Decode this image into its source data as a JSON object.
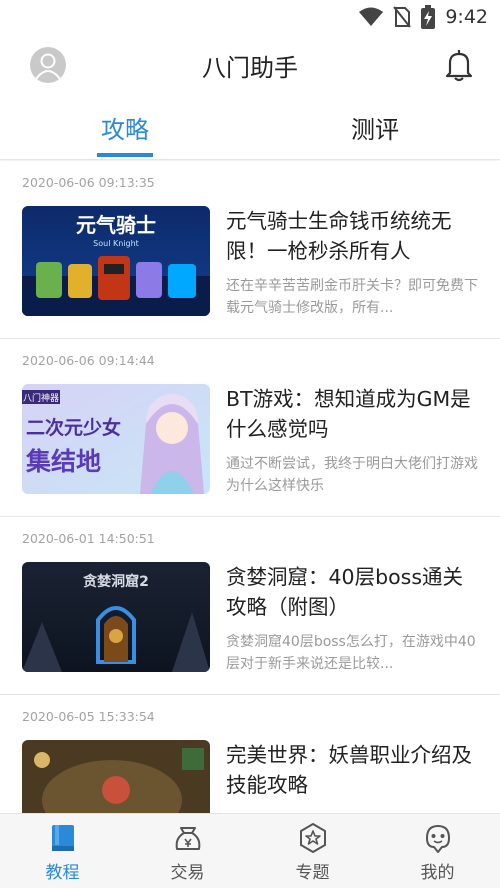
{
  "status_bar": {
    "time": "9:42"
  },
  "header": {
    "title": "八门助手"
  },
  "tabs": [
    {
      "label": "攻略",
      "active": true
    },
    {
      "label": "测评",
      "active": false
    }
  ],
  "articles": [
    {
      "date": "2020-06-06 09:13:35",
      "title": "元气骑士生命钱币统统无限！一枪秒杀所有人",
      "summary": "还在辛辛苦苦刷金币肝关卡？即可免费下载元气骑士修改版，所有...",
      "thumb_text": "元气骑士",
      "thumb_sub": "Soul Knight"
    },
    {
      "date": "2020-06-06 09:14:44",
      "title": "BT游戏：想知道成为GM是什么感觉吗",
      "summary": "通过不断尝试，我终于明白大佬们打游戏为什么这样快乐",
      "thumb_tag": "八门神器",
      "thumb_line1": "二次元少女",
      "thumb_line2": "集结地"
    },
    {
      "date": "2020-06-01 14:50:51",
      "title": "贪婪洞窟：40层boss通关攻略（附图）",
      "summary": "贪婪洞窟40层boss怎么打，在游戏中40层对于新手来说还是比较...",
      "thumb_text": "贪婪洞窟2"
    },
    {
      "date": "2020-06-05 15:33:54",
      "title": "完美世界：妖兽职业介绍及技能攻略",
      "summary": ""
    }
  ],
  "bottom_nav": [
    {
      "label": "教程",
      "icon": "book-icon",
      "active": true
    },
    {
      "label": "交易",
      "icon": "bag-icon",
      "active": false
    },
    {
      "label": "专题",
      "icon": "star-badge-icon",
      "active": false
    },
    {
      "label": "我的",
      "icon": "robot-face-icon",
      "active": false
    }
  ],
  "colors": {
    "accent": "#2a8ad8",
    "text": "#222222",
    "muted": "#9a9a9a"
  }
}
